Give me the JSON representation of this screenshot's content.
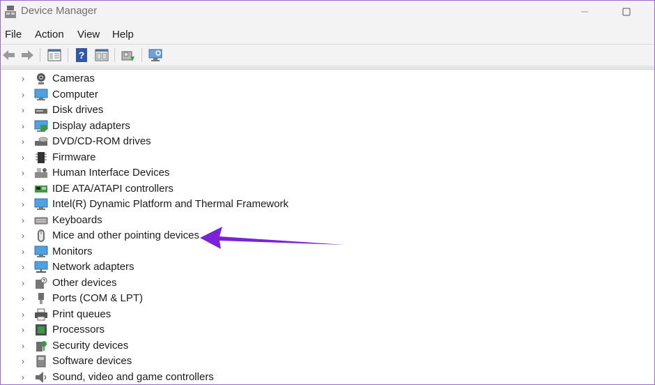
{
  "window": {
    "title": "Device Manager"
  },
  "menu": [
    "File",
    "Action",
    "View",
    "Help"
  ],
  "toolbar": {
    "buttons": [
      "back-icon",
      "forward-icon",
      "show-hide-console-tree-icon",
      "help-icon",
      "properties-icon",
      "update-driver-icon",
      "scan-hardware-icon"
    ]
  },
  "devices": [
    {
      "label": "Cameras",
      "icon": "camera-icon"
    },
    {
      "label": "Computer",
      "icon": "computer-icon"
    },
    {
      "label": "Disk drives",
      "icon": "disk-drive-icon"
    },
    {
      "label": "Display adapters",
      "icon": "display-adapter-icon"
    },
    {
      "label": "DVD/CD-ROM drives",
      "icon": "dvd-drive-icon"
    },
    {
      "label": "Firmware",
      "icon": "firmware-icon"
    },
    {
      "label": "Human Interface Devices",
      "icon": "hid-icon"
    },
    {
      "label": "IDE ATA/ATAPI controllers",
      "icon": "ide-controller-icon"
    },
    {
      "label": "Intel(R) Dynamic Platform and Thermal Framework",
      "icon": "thermal-framework-icon"
    },
    {
      "label": "Keyboards",
      "icon": "keyboard-icon"
    },
    {
      "label": "Mice and other pointing devices",
      "icon": "mouse-icon"
    },
    {
      "label": "Monitors",
      "icon": "monitor-icon"
    },
    {
      "label": "Network adapters",
      "icon": "network-adapter-icon"
    },
    {
      "label": "Other devices",
      "icon": "unknown-device-icon"
    },
    {
      "label": "Ports (COM & LPT)",
      "icon": "port-icon"
    },
    {
      "label": "Print queues",
      "icon": "printer-icon"
    },
    {
      "label": "Processors",
      "icon": "processor-icon"
    },
    {
      "label": "Security devices",
      "icon": "security-device-icon"
    },
    {
      "label": "Software devices",
      "icon": "software-device-icon"
    },
    {
      "label": "Sound, video and game controllers",
      "icon": "speaker-icon"
    }
  ],
  "annotation": {
    "points_to": "Mice and other pointing devices",
    "color": "#7b22d8"
  },
  "colors": {
    "accent": "#7b22d8",
    "chrome": "#f3f3f3",
    "window_border": "#9b68c8"
  }
}
